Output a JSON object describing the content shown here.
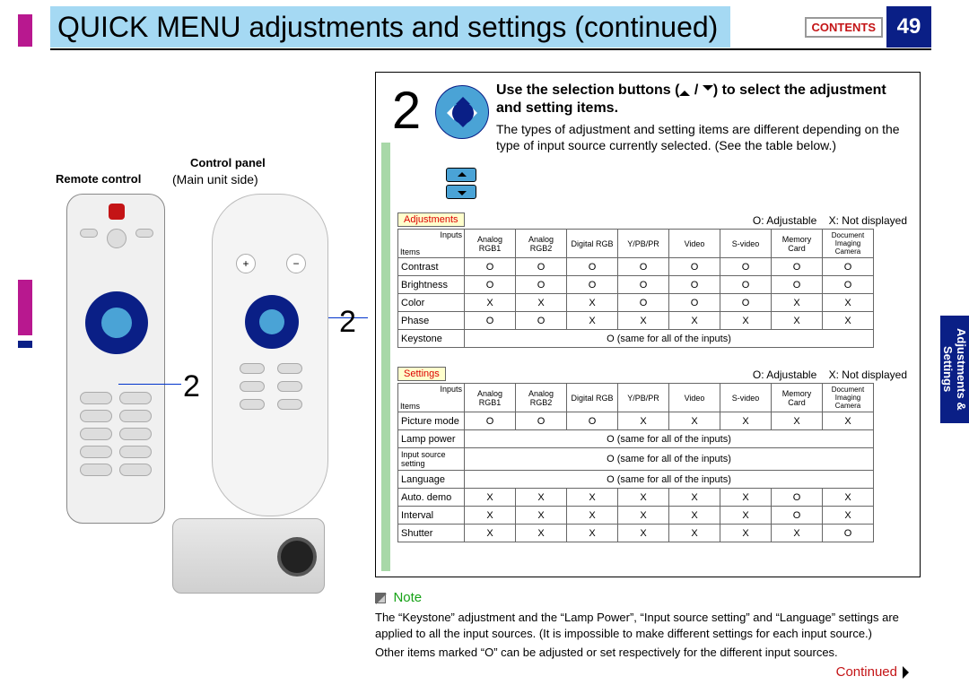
{
  "header": {
    "title": "QUICK MENU adjustments and settings (continued)",
    "contents_btn": "CONTENTS",
    "page_number": "49"
  },
  "side_tab": "Adjustments & Settings",
  "labels": {
    "remote_control": "Remote control",
    "control_panel": "Control panel",
    "main_unit_side": "(Main unit side)",
    "step_callout": "2"
  },
  "step": {
    "number": "2",
    "heading_before": "Use the selection buttons (",
    "heading_after": ") to select the adjustment and setting items.",
    "desc": "The types of adjustment and setting items are different depending on the type of input source currently selected. (See the table below.)"
  },
  "legend": {
    "adjustable": "O: Adjustable",
    "not_displayed": "X: Not displayed"
  },
  "tabs": {
    "adjustments": "Adjustments",
    "settings": "Settings"
  },
  "table_headers": {
    "items": "Items",
    "inputs": "Inputs",
    "cols": [
      "Analog RGB1",
      "Analog RGB2",
      "Digital RGB",
      "Y/PB/PR",
      "Video",
      "S-video",
      "Memory Card",
      "Document Imaging Camera"
    ]
  },
  "adjustments_rows": [
    {
      "name": "Contrast",
      "cells": [
        "O",
        "O",
        "O",
        "O",
        "O",
        "O",
        "O",
        "O"
      ]
    },
    {
      "name": "Brightness",
      "cells": [
        "O",
        "O",
        "O",
        "O",
        "O",
        "O",
        "O",
        "O"
      ]
    },
    {
      "name": "Color",
      "cells": [
        "X",
        "X",
        "X",
        "O",
        "O",
        "O",
        "X",
        "X"
      ]
    },
    {
      "name": "Phase",
      "cells": [
        "O",
        "O",
        "X",
        "X",
        "X",
        "X",
        "X",
        "X"
      ]
    },
    {
      "name": "Keystone",
      "same": "O  (same for all of the inputs)"
    }
  ],
  "settings_rows": [
    {
      "name": "Picture mode",
      "cells": [
        "O",
        "O",
        "O",
        "X",
        "X",
        "X",
        "X",
        "X"
      ]
    },
    {
      "name": "Lamp power",
      "same": "O  (same for all of the inputs)"
    },
    {
      "name": "Input source setting",
      "same": "O  (same for all of the inputs)"
    },
    {
      "name": "Language",
      "same": "O  (same for all of the inputs)"
    },
    {
      "name": "Auto. demo",
      "cells": [
        "X",
        "X",
        "X",
        "X",
        "X",
        "X",
        "O",
        "X"
      ]
    },
    {
      "name": "Interval",
      "cells": [
        "X",
        "X",
        "X",
        "X",
        "X",
        "X",
        "O",
        "X"
      ]
    },
    {
      "name": "Shutter",
      "cells": [
        "X",
        "X",
        "X",
        "X",
        "X",
        "X",
        "X",
        "O"
      ]
    }
  ],
  "note": {
    "label": "Note",
    "p1": "The “Keystone” adjustment and the “Lamp Power”, “Input source setting” and “Language” settings are applied to all the input sources.  (It is impossible to make different settings for each input source.)",
    "p2": "Other items marked “O” can be adjusted or set respectively for the different input sources."
  },
  "continued_label": "Continued"
}
